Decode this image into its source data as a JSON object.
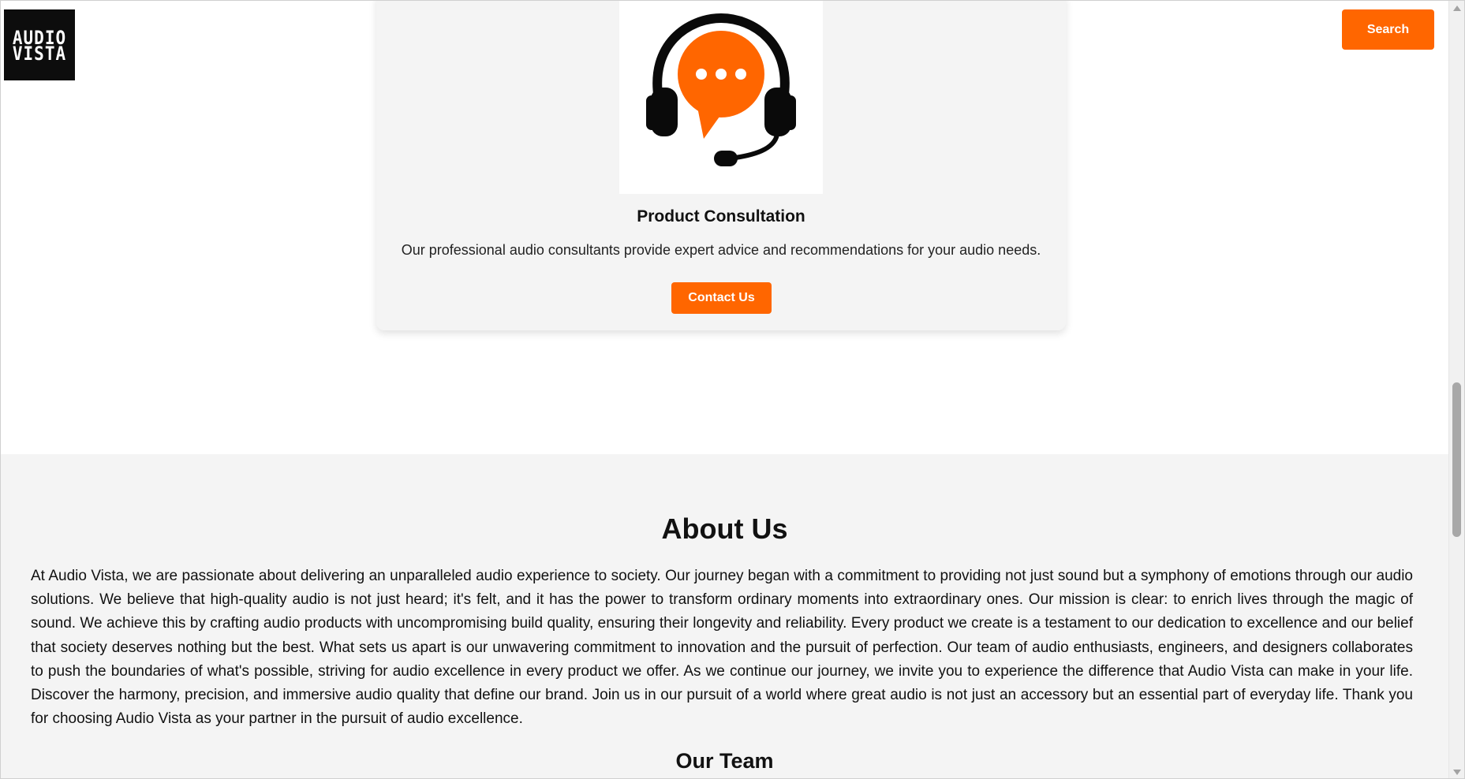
{
  "header": {
    "logo_line1": "AUDIO",
    "logo_line2": "VISTA",
    "search_label": "Search"
  },
  "service_card": {
    "icon": "support-headset-chat-icon",
    "title": "Product Consultation",
    "description": "Our professional audio consultants provide expert advice and recommendations for your audio needs.",
    "button_label": "Contact Us"
  },
  "about": {
    "title": "About Us",
    "text": "At Audio Vista, we are passionate about delivering an unparalleled audio experience to society. Our journey began with a commitment to providing not just sound but a symphony of emotions through our audio solutions. We believe that high-quality audio is not just heard; it's felt, and it has the power to transform ordinary moments into extraordinary ones. Our mission is clear: to enrich lives through the magic of sound. We achieve this by crafting audio products with uncompromising build quality, ensuring their longevity and reliability. Every product we create is a testament to our dedication to excellence and our belief that society deserves nothing but the best. What sets us apart is our unwavering commitment to innovation and the pursuit of perfection. Our team of audio enthusiasts, engineers, and designers collaborates to push the boundaries of what's possible, striving for audio excellence in every product we offer. As we continue our journey, we invite you to experience the difference that Audio Vista can make in your life. Discover the harmony, precision, and immersive audio quality that define our brand. Join us in our pursuit of a world where great audio is not just an accessory but an essential part of everyday life. Thank you for choosing Audio Vista as your partner in the pursuit of audio excellence.",
    "team_title": "Our Team"
  },
  "colors": {
    "accent": "#ff6600",
    "section_background": "#f4f4f4",
    "logo_background": "#0d0d0d"
  }
}
